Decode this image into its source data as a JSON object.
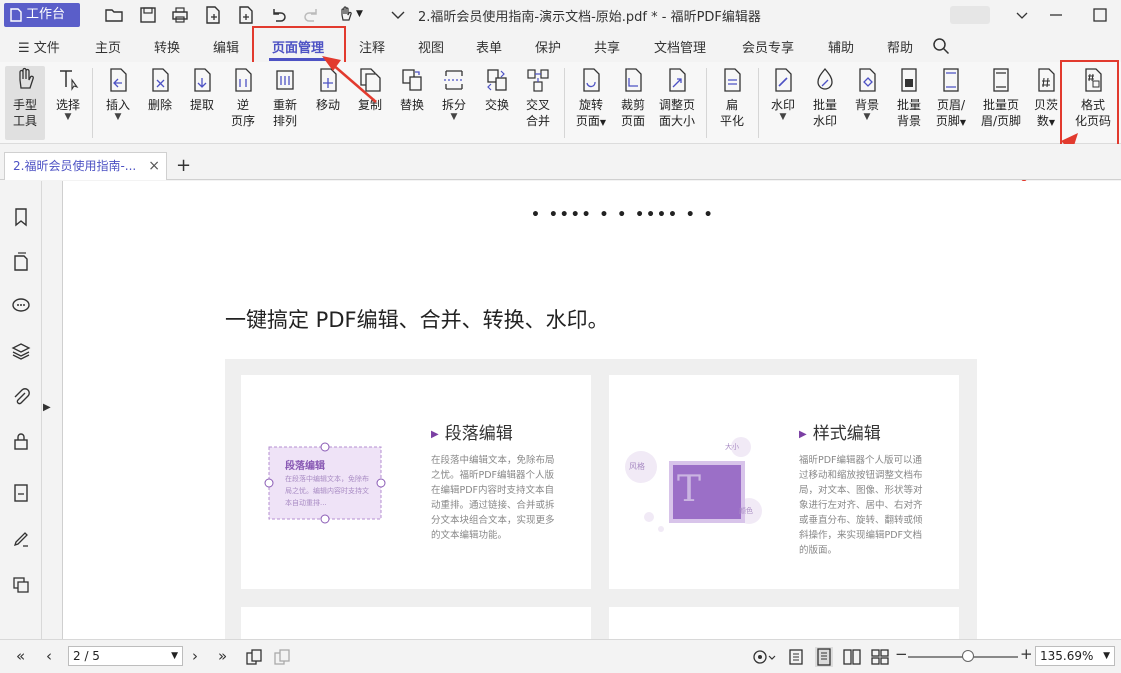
{
  "titlebar": {
    "workbench_label": "工作台",
    "document_title": "2.福昕会员使用指南-演示文档-原始.pdf * - 福昕PDF编辑器"
  },
  "menu": {
    "file": "文件",
    "items": [
      "主页",
      "转换",
      "编辑",
      "页面管理",
      "注释",
      "视图",
      "表单",
      "保护",
      "共享",
      "文档管理",
      "会员专享",
      "辅助",
      "帮助"
    ],
    "active": "页面管理"
  },
  "ribbon": {
    "hand_tool": "手型\n工具",
    "select": "选择",
    "insert": "插入",
    "delete": "删除",
    "extract": "提取",
    "reverse_l1": "逆",
    "reverse_l2": "页序",
    "reorder_l1": "重新",
    "reorder_l2": "排列",
    "move": "移动",
    "copy": "复制",
    "replace": "替换",
    "split": "拆分",
    "swap": "交换",
    "cross_merge_l1": "交叉",
    "cross_merge_l2": "合并",
    "rotate_l1": "旋转",
    "rotate_l2": "页面",
    "crop_l1": "裁剪",
    "crop_l2": "页面",
    "resize_l1": "调整页",
    "resize_l2": "面大小",
    "flatten_l1": "扁",
    "flatten_l2": "平化",
    "watermark": "水印",
    "batch_watermark_l1": "批量",
    "batch_watermark_l2": "水印",
    "background": "背景",
    "batch_background_l1": "批量",
    "batch_background_l2": "背景",
    "header_footer_l1": "页眉/",
    "header_footer_l2": "页脚",
    "batch_header_l1": "批量页",
    "batch_header_l2": "眉/页脚",
    "bates_l1": "贝茨",
    "bates_l2": "数",
    "format_page_l1": "格式",
    "format_page_l2": "化页码"
  },
  "tabs": {
    "doc_tab_label": "2.福昕会员使用指南-...",
    "close": "×",
    "add": "+"
  },
  "document": {
    "headline": "一键搞定 PDF编辑、合并、转换、水印。",
    "card1": {
      "title": "段落编辑",
      "body": "在段落中编辑文本，免除布局之忧。福昕PDF编辑器个人版在编辑PDF内容时支持文本自动重排。通过链接、合并或拆分文本块组合文本，实现更多的文本编辑功能。",
      "illus_title": "段落编辑",
      "illus_text": "在段落中编辑文本，免除布局之忧。编辑内容时支持文本自动重排..."
    },
    "card2": {
      "title": "样式编辑",
      "body": "福昕PDF编辑器个人版可以通过移动和缩放按钮调整文档布局，对文本、图像、形状等对象进行左对齐、居中、右对齐或垂直分布、旋转、翻转或倾斜操作，来实现编辑PDF文档的版面。",
      "tag_style": "风格",
      "tag_size": "大小",
      "tag_color": "颜色",
      "big_letter": "T"
    }
  },
  "statusbar": {
    "page": "2 / 5",
    "zoom": "135.69%"
  },
  "colors": {
    "accent": "#4d52c4",
    "highlight_red": "#e23a2e",
    "illustration_purple": "#9b6fc7"
  }
}
